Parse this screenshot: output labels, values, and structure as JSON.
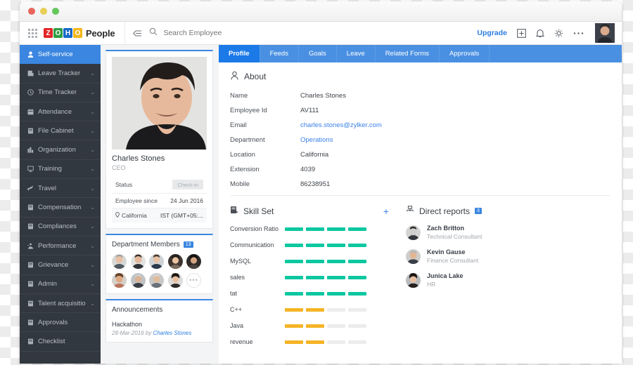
{
  "window": {
    "dots": [
      "close",
      "minimize",
      "maximize"
    ]
  },
  "header": {
    "apps_icon": "grid-apps-icon",
    "logo": {
      "letters": [
        "Z",
        "O",
        "H",
        "O"
      ],
      "product": "People"
    },
    "collapse_icon": "collapse-sidebar-icon",
    "search": {
      "icon": "search-icon",
      "placeholder": "Search Employee",
      "value": ""
    },
    "upgrade_label": "Upgrade",
    "icons": [
      "add-box-icon",
      "bell-icon",
      "gear-icon",
      "more-horizontal-icon"
    ],
    "avatar": "header-user-avatar"
  },
  "sidebar": {
    "items": [
      {
        "label": "Self-service",
        "icon": "user-icon",
        "active": true,
        "chevron": false
      },
      {
        "label": "Leave Tracker",
        "icon": "leave-icon",
        "active": false,
        "chevron": true
      },
      {
        "label": "Time Tracker",
        "icon": "clock-icon",
        "active": false,
        "chevron": true
      },
      {
        "label": "Attendance",
        "icon": "calendar-icon",
        "active": false,
        "chevron": true
      },
      {
        "label": "File Cabinet",
        "icon": "file-icon",
        "active": false,
        "chevron": true
      },
      {
        "label": "Organization",
        "icon": "org-chart-icon",
        "active": false,
        "chevron": true
      },
      {
        "label": "Training",
        "icon": "training-icon",
        "active": false,
        "chevron": true
      },
      {
        "label": "Travel",
        "icon": "plane-icon",
        "active": false,
        "chevron": true
      },
      {
        "label": "Compensation",
        "icon": "document-icon",
        "active": false,
        "chevron": true
      },
      {
        "label": "Compliances",
        "icon": "document-icon",
        "active": false,
        "chevron": true
      },
      {
        "label": "Performance",
        "icon": "performance-icon",
        "active": false,
        "chevron": true
      },
      {
        "label": "Grievance",
        "icon": "document-icon",
        "active": false,
        "chevron": true
      },
      {
        "label": "Admin",
        "icon": "document-icon",
        "active": false,
        "chevron": true
      },
      {
        "label": "Talent acquisition",
        "icon": "document-icon",
        "active": false,
        "chevron": true
      },
      {
        "label": "Approvals",
        "icon": "document-icon",
        "active": false,
        "chevron": false
      },
      {
        "label": "Checklist",
        "icon": "document-icon",
        "active": false,
        "chevron": false
      }
    ]
  },
  "profile_card": {
    "photo": "employee-photo",
    "name": "Charles Stones",
    "role": "CEO",
    "rows": [
      {
        "key": "Status",
        "value": "Check-in",
        "type": "button"
      },
      {
        "key": "Employee since",
        "value": "24 Jun 2016",
        "type": "text"
      },
      {
        "key": "California",
        "value": "IST (GMT+05:...",
        "type": "location"
      }
    ]
  },
  "department_members": {
    "title": "Department Members",
    "count": "13",
    "avatar_count": 9,
    "more_label": "•••"
  },
  "announcements": {
    "title": "Announcements",
    "items": [
      {
        "heading": "Hackathon",
        "date": "28-Mar-2016 by ",
        "author": "Charles Stones"
      }
    ]
  },
  "tabs": [
    {
      "label": "Profile",
      "active": true
    },
    {
      "label": "Feeds",
      "active": false
    },
    {
      "label": "Goals",
      "active": false
    },
    {
      "label": "Leave",
      "active": false
    },
    {
      "label": "Related Forms",
      "active": false
    },
    {
      "label": "Approvals",
      "active": false
    }
  ],
  "about": {
    "icon": "person-outline-icon",
    "title": "About",
    "fields": [
      {
        "key": "Name",
        "value": "Charles Stones",
        "link": false
      },
      {
        "key": "Employee Id",
        "value": "AV111",
        "link": false
      },
      {
        "key": "Email",
        "value": "charles.stones@zylker.com",
        "link": true
      },
      {
        "key": "Department",
        "value": "Operations",
        "link": true
      },
      {
        "key": "Location",
        "value": "California",
        "link": false
      },
      {
        "key": "Extension",
        "value": "4039",
        "link": false
      },
      {
        "key": "Mobile",
        "value": "86238951",
        "link": false
      }
    ]
  },
  "skill_set": {
    "icon": "skills-icon",
    "title": "Skill Set",
    "add_label": "+",
    "max_level": 4,
    "skills": [
      {
        "name": "Conversion Ratio",
        "level": 4,
        "color": "green"
      },
      {
        "name": "Communication",
        "level": 4,
        "color": "green"
      },
      {
        "name": "MySQL",
        "level": 4,
        "color": "green"
      },
      {
        "name": "sales",
        "level": 4,
        "color": "green"
      },
      {
        "name": "tat",
        "level": 4,
        "color": "green"
      },
      {
        "name": "C++",
        "level": 2,
        "color": "yellow"
      },
      {
        "name": "Java",
        "level": 2,
        "color": "yellow"
      },
      {
        "name": "revenue",
        "level": 2,
        "color": "yellow"
      }
    ]
  },
  "direct_reports": {
    "icon": "org-reports-icon",
    "title": "Direct reports",
    "count": "3",
    "people": [
      {
        "name": "Zach Britton",
        "title": "Technical Consultant"
      },
      {
        "name": "Kevin Gause",
        "title": "Finance Consultant"
      },
      {
        "name": "Junica Lake",
        "title": "HR"
      }
    ]
  },
  "colors": {
    "accent_blue": "#3a86e0",
    "tab_blue": "#4a90e2",
    "tab_active_blue": "#1b7ae8",
    "sidebar_dark": "#32383f",
    "skill_green": "#0cc7a0",
    "skill_yellow": "#f5b426",
    "link_blue": "#3b82e8"
  }
}
